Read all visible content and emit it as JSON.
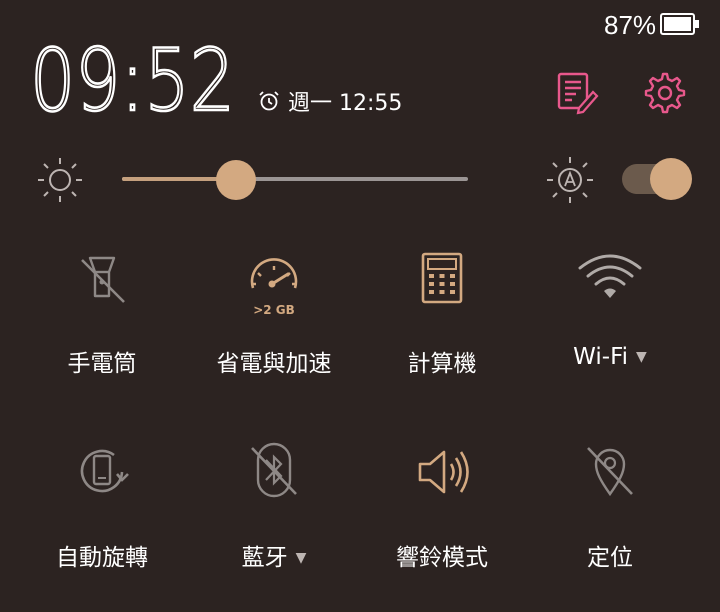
{
  "status_bar": {
    "battery_percent": "87%"
  },
  "header": {
    "clock": "09:52",
    "alarm_text": "週一 12:55"
  },
  "brightness": {
    "level_fraction": 0.33,
    "auto_enabled": true
  },
  "colors": {
    "accent": "#d3a981",
    "pink": "#e8588c",
    "background": "#2c2321",
    "inactive": "#8e8886"
  },
  "tiles": [
    {
      "label": "手電筒",
      "icon": "flashlight-off-icon",
      "active": false
    },
    {
      "label": "省電與加速",
      "icon": "speedometer-icon",
      "sublabel": ">2 GB",
      "active": true
    },
    {
      "label": "計算機",
      "icon": "calculator-icon",
      "active": true
    },
    {
      "label": "Wi-Fi",
      "icon": "wifi-icon",
      "active": false,
      "has_dropdown": true
    },
    {
      "label": "自動旋轉",
      "icon": "auto-rotate-icon",
      "active": false
    },
    {
      "label": "藍牙",
      "icon": "bluetooth-off-icon",
      "active": false,
      "has_dropdown": true
    },
    {
      "label": "響鈴模式",
      "icon": "speaker-icon",
      "active": true
    },
    {
      "label": "定位",
      "icon": "location-off-icon",
      "active": false
    }
  ]
}
